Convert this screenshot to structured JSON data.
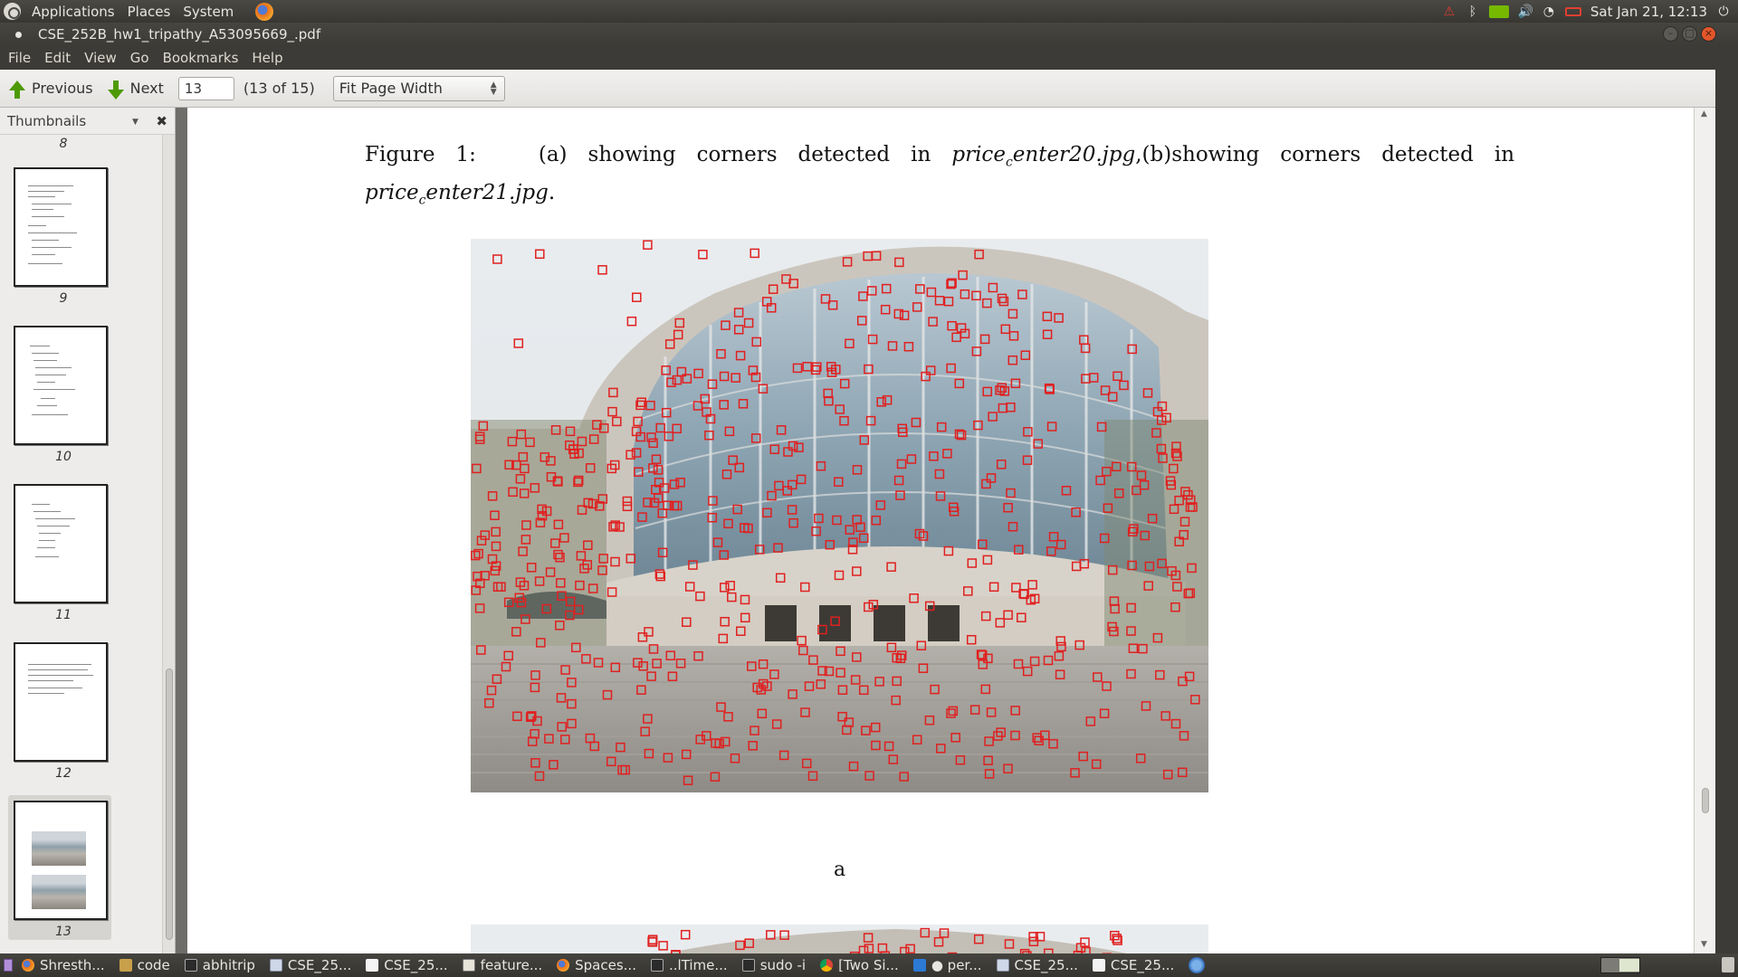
{
  "top_panel": {
    "menus": [
      "Applications",
      "Places",
      "System"
    ],
    "clock": "Sat Jan 21, 12:13",
    "tray_icons": [
      "warning-icon",
      "bluetooth-icon",
      "nvidia-icon",
      "volume-icon",
      "wifi-icon",
      "battery-icon",
      "power-icon"
    ]
  },
  "window": {
    "title": "CSE_252B_hw1_tripathy_A53095669_.pdf"
  },
  "menu_bar": [
    "File",
    "Edit",
    "View",
    "Go",
    "Bookmarks",
    "Help"
  ],
  "toolbar": {
    "previous_label": "Previous",
    "next_label": "Next",
    "page_value": "13",
    "page_count": "(13 of 15)",
    "zoom_value": "Fit Page Width"
  },
  "sidebar": {
    "title": "Thumbnails",
    "top_label": "8",
    "pages": [
      "9",
      "10",
      "11",
      "12",
      "13"
    ],
    "selected_page": "13"
  },
  "document": {
    "caption_parts": {
      "prefix": "Figure 1:",
      "a": "(a) showing corners detected in",
      "file1_main": "price",
      "file1_sub": "c",
      "file1_rest": "enter20.jpg",
      "b": ",(b)showing corners detected in",
      "file2_main": "price",
      "file2_sub": "c",
      "file2_rest": "enter21.jpg",
      "end": "."
    },
    "subfigure_label": "a"
  },
  "taskbar": {
    "tasks": [
      {
        "label": "Shresth...",
        "icon": "firefox-icon"
      },
      {
        "label": "code",
        "icon": "folder-icon"
      },
      {
        "label": "abhitrip",
        "icon": "terminal-icon"
      },
      {
        "label": "CSE_25...",
        "icon": "pdf-icon"
      },
      {
        "label": "CSE_25...",
        "icon": "document-icon"
      },
      {
        "label": "feature...",
        "icon": "text-editor-icon"
      },
      {
        "label": "Spaces...",
        "icon": "firefox-icon"
      },
      {
        "label": "..lTime...",
        "icon": "terminal-icon"
      },
      {
        "label": "sudo -i",
        "icon": "terminal-icon"
      },
      {
        "label": "[Two Si...",
        "icon": "chrome-icon"
      },
      {
        "label": "● per...",
        "icon": "vscode-icon"
      },
      {
        "label": "CSE_25...",
        "icon": "pdf-icon"
      },
      {
        "label": "CSE_25...",
        "icon": "document-icon"
      }
    ]
  },
  "colors": {
    "panel_bg": "#3c3b37",
    "corner_marker": "#e02020",
    "page_bg": "#ffffff",
    "accent_green": "#4e9a06"
  }
}
